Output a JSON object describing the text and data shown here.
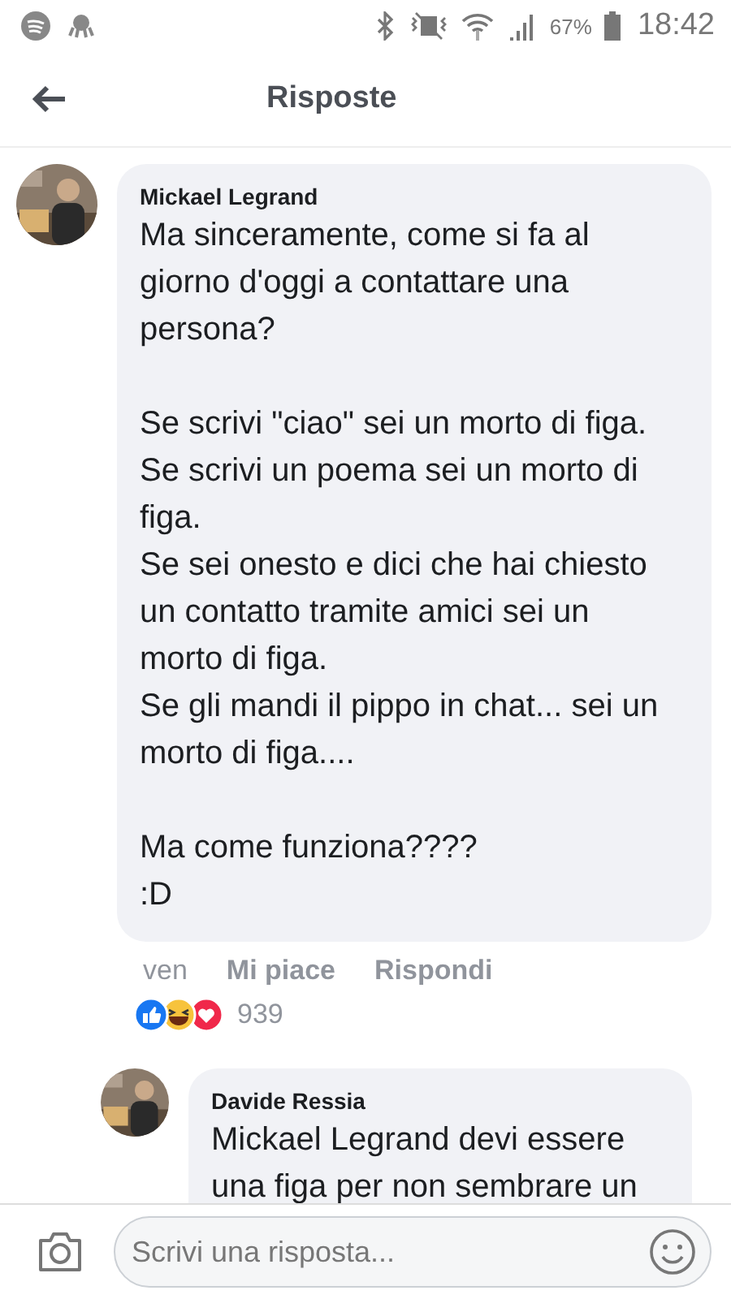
{
  "status_bar": {
    "battery": "67%",
    "time": "18:42"
  },
  "header": {
    "title": "Risposte"
  },
  "comment": {
    "author": "Mickael Legrand",
    "paragraphs": [
      [
        "Ma sinceramente, come si fa al giorno d'oggi a contattare una persona?"
      ],
      [
        "Se scrivi \"ciao\" sei un morto di figa.",
        "Se scrivi un poema sei un morto di figa.",
        "Se sei onesto e dici che hai chiesto un contatto tramite amici sei un morto di figa.",
        "Se gli mandi il pippo in chat... sei un morto di figa...."
      ],
      [
        "Ma come funziona????",
        ":D"
      ]
    ],
    "time": "ven",
    "actions": [
      "Mi piace",
      "Rispondi"
    ],
    "reaction_count": "939",
    "reactions": [
      {
        "kind": "like"
      },
      {
        "kind": "haha"
      },
      {
        "kind": "love"
      }
    ]
  },
  "reply": {
    "author": "Davide Ressia",
    "text": "Mickael Legrand devi essere una figa per non sembrare un"
  },
  "composer": {
    "placeholder": "Scrivi una risposta..."
  }
}
